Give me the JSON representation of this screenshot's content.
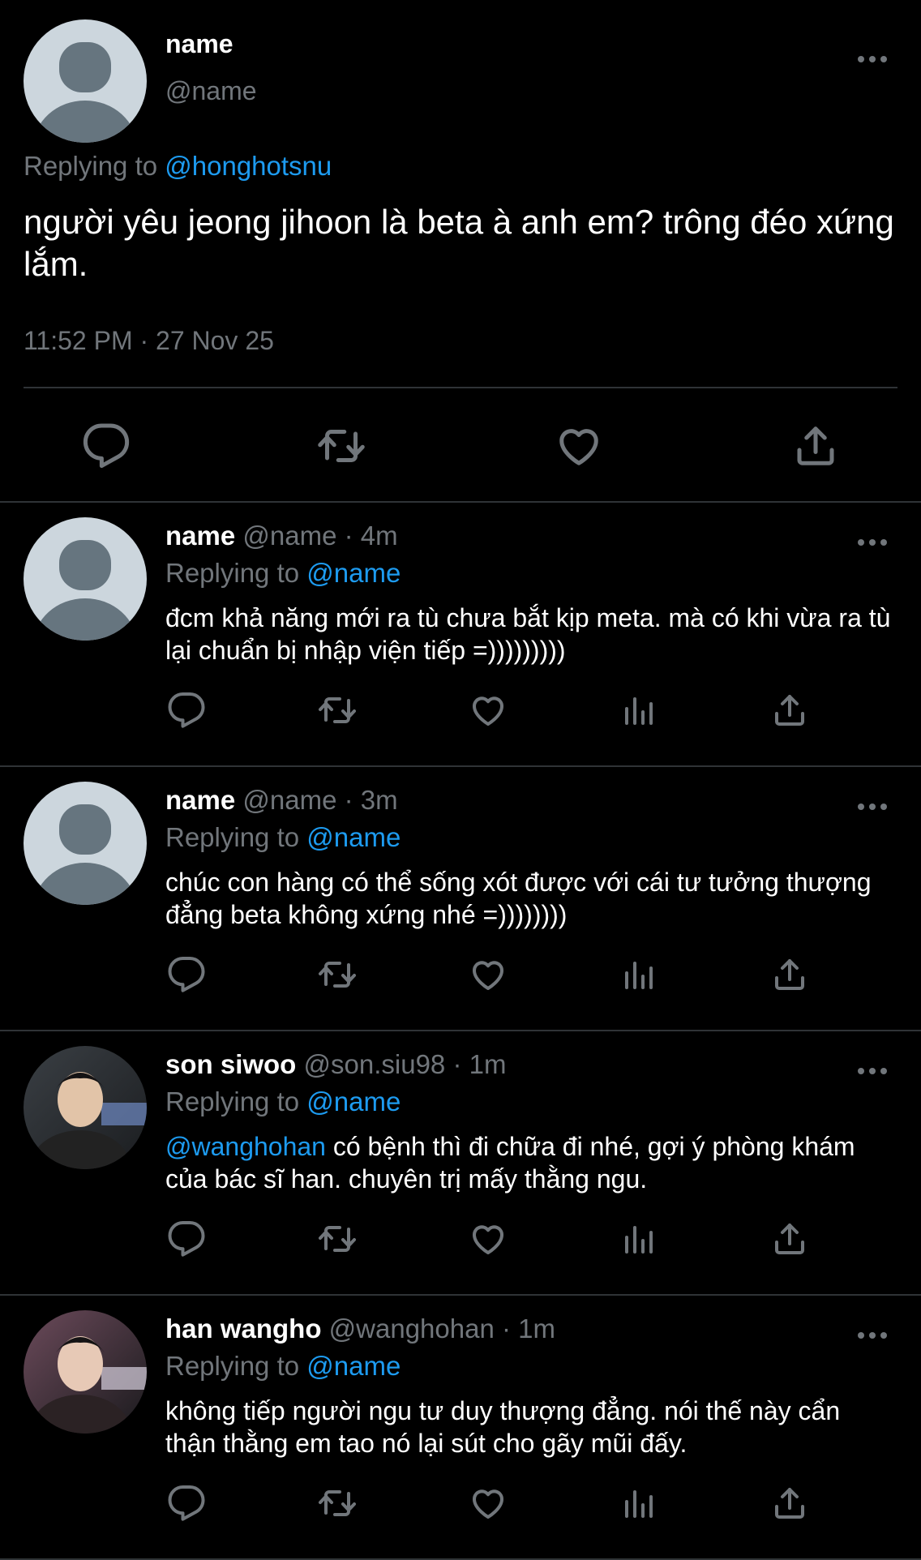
{
  "main_tweet": {
    "name": "name",
    "handle": "@name",
    "replying_label": "Replying to ",
    "replying_to": "@honghotsnu",
    "text": "người yêu jeong jihoon là beta à anh em? trông đéo xứng lắm.",
    "timestamp": "11:52 PM · 27 Nov 25",
    "actions": [
      "reply-icon",
      "retweet-icon",
      "like-icon",
      "share-icon"
    ]
  },
  "replies": [
    {
      "name": "name",
      "handle": "@name",
      "separator": " · ",
      "ago": "4m",
      "replying_label": "Replying to ",
      "replying_to": "@name",
      "mention": "",
      "text": "đcm khả năng mới ra tù chưa bắt kịp meta. mà có khi vừa ra tù lại chuẩn bị nhập viện tiếp =)))))))))",
      "avatar": "default"
    },
    {
      "name": "name",
      "handle": "@name",
      "separator": " · ",
      "ago": "3m",
      "replying_label": "Replying to ",
      "replying_to": "@name",
      "mention": "",
      "text": "chúc con hàng có thể sống xót được với cái tư tưởng thượng đẳng beta không xứng nhé =))))))))",
      "avatar": "default"
    },
    {
      "name": "son siwoo",
      "handle": "@son.siu98",
      "separator": " · ",
      "ago": "1m",
      "replying_label": "Replying to ",
      "replying_to": "@name",
      "mention": "@wanghohan",
      "text": " có bệnh thì đi chữa đi nhé, gợi ý phòng khám của bác sĩ han. chuyên trị mấy thằng ngu.",
      "avatar": "photo"
    },
    {
      "name": "han wangho",
      "handle": "@wanghohan",
      "separator": " · ",
      "ago": "1m",
      "replying_label": "Replying to ",
      "replying_to": "@name",
      "mention": "",
      "text": "không tiếp người ngu tư duy thượng đẳng. nói thế này cẩn thận thằng em tao nó lại sút cho gãy mũi đấy.",
      "avatar": "photo"
    }
  ],
  "reply_actions": [
    "reply-icon",
    "retweet-icon",
    "like-icon",
    "views-icon",
    "share-icon"
  ],
  "colors": {
    "background": "#000000",
    "text": "#e7e9ea",
    "muted": "#71767b",
    "link": "#1d9bf0",
    "divider": "#2f3336",
    "avatar_bg": "#ccd6dd",
    "avatar_fg": "#66757f"
  }
}
